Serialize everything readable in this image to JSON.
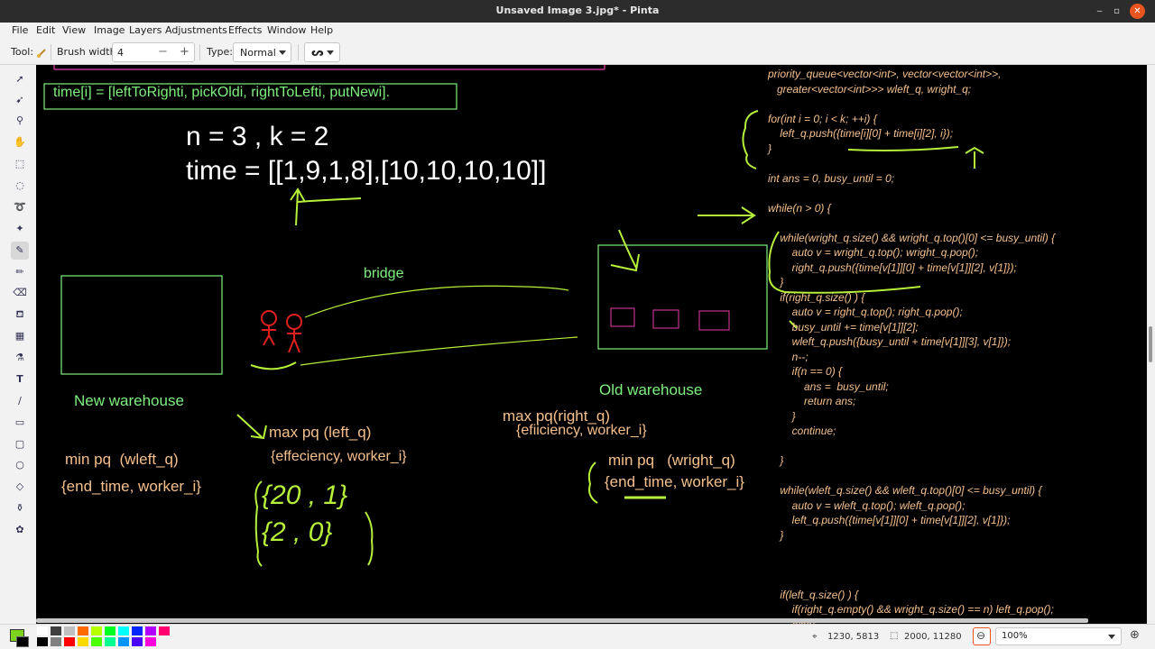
{
  "window": {
    "title": "Unsaved Image 3.jpg* - Pinta",
    "min": "‒",
    "max": "▫",
    "close": "✕"
  },
  "menu": [
    "File",
    "Edit",
    "View",
    "Image",
    "Layers",
    "Adjustments",
    "Effects",
    "Window",
    "Help"
  ],
  "toolbar": {
    "tool_label": "Tool:",
    "brush_width_label": "Brush width:",
    "brush_width_value": "4",
    "minus": "−",
    "plus": "+",
    "type_label": "Type:",
    "type_value": "Normal",
    "stroke_glyph": "ᔕ"
  },
  "canvas": {
    "time_def": "time[i] = [leftToRighti, pickOldi, rightToLefti, putNewi].",
    "n_k": "n = 3 , k = 2",
    "time_val": "time = [[1,9,1,8],[10,10,10,10]]",
    "bridge": "bridge",
    "new_warehouse": "New warehouse",
    "old_warehouse": "Old warehouse",
    "max_pq_left": "max pq (left_q)",
    "max_pq_left_sub": "{effeciency, worker_i}",
    "max_pq_right": "max pq(right_q)",
    "max_pq_right_sub": "{efiiciency, worker_i}",
    "min_pq_wleft": "min pq  (wleft_q)",
    "min_pq_wleft_sub": "{end_time, worker_i}",
    "min_pq_wright": "min pq   (wright_q)",
    "min_pq_wright_sub": "{end_time, worker_i}",
    "hw_set_1": "{20 , 1}",
    "hw_set_2": "{2 , 0}",
    "code_lines": [
      "priority_queue<vector<int>, vector<vector<int>>,",
      "   greater<vector<int>>> wleft_q, wright_q;",
      "",
      "for(int i = 0; i < k; ++i) {",
      "    left_q.push({time[i][0] + time[i][2], i});",
      "}",
      "",
      "int ans = 0, busy_until = 0;",
      "",
      "while(n > 0) {",
      "",
      "    while(wright_q.size() && wright_q.top()[0] <= busy_until) {",
      "        auto v = wright_q.top(); wright_q.pop();",
      "        right_q.push({time[v[1]][0] + time[v[1]][2], v[1]});",
      "    }",
      "    if(right_q.size() ) {",
      "        auto v = right_q.top(); right_q.pop();",
      "        busy_until += time[v[1]][2];",
      "        wleft_q.push({busy_until + time[v[1]][3], v[1]});",
      "        n--;",
      "        if(n == 0) {",
      "            ans =  busy_until;",
      "            return ans;",
      "        }",
      "        continue;",
      "",
      "    }",
      "",
      "    while(wleft_q.size() && wleft_q.top()[0] <= busy_until) {",
      "        auto v = wleft_q.top(); wleft_q.pop();",
      "        left_q.push({time[v[1]][0] + time[v[1]][2], v[1]});",
      "    }",
      "",
      "",
      "",
      "    if(left_q.size() ) {",
      "        if(right_q.empty() && wright_q.size() == n) left_q.pop();",
      "        else{"
    ]
  },
  "status": {
    "cursor_pos": "1230, 5813",
    "selection_size": "2000, 11280",
    "zoom": "100%"
  },
  "palette_colors": [
    "#ffffff",
    "#000000",
    "#404040",
    "#808080",
    "#c0c0c0",
    "#ff0000",
    "#ff6a00",
    "#ffd800",
    "#b6ff00",
    "#4cff00",
    "#00ff21",
    "#00ff90",
    "#00ffff",
    "#0094ff",
    "#0026ff",
    "#4800ff",
    "#b200ff",
    "#ff00dc",
    "#ff006e"
  ],
  "colors": {
    "primary": "#7ed321",
    "canvas_bg": "#000000",
    "code": "#f4c08e",
    "green_text": "#7ef07e",
    "red_figure": "#e0201e",
    "magenta": "#c0338f",
    "chalk_green": "#b6f03a"
  }
}
